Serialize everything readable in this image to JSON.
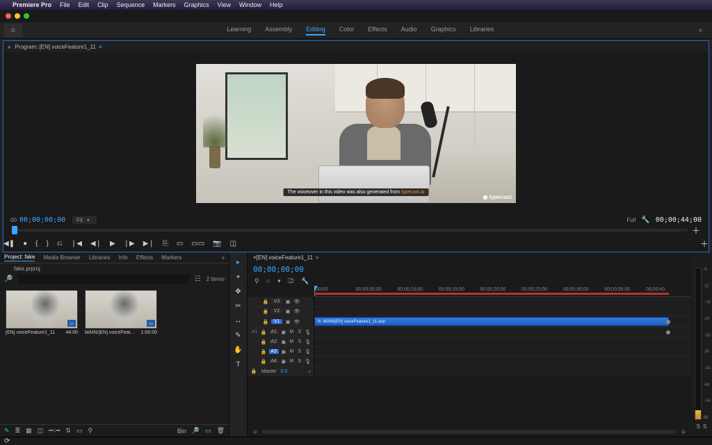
{
  "menubar": {
    "app": "Premiere Pro",
    "items": [
      "File",
      "Edit",
      "Clip",
      "Sequence",
      "Markers",
      "Graphics",
      "View",
      "Window",
      "Help"
    ]
  },
  "workspaces": {
    "items": [
      "Learning",
      "Assembly",
      "Editing",
      "Color",
      "Effects",
      "Audio",
      "Graphics",
      "Libraries"
    ],
    "active": "Editing"
  },
  "program": {
    "tab_label": "Program: [EN] voiceFeature1_11",
    "subtitle_pre": "The voiceover in this video was also generated from ",
    "subtitle_hl": "typecast.ai",
    "watermark": "typecast",
    "timecode": "00;00;00;00",
    "fit_label": "Fit",
    "full_label": "Full",
    "duration": "00;00;44;00",
    "left_label": "00"
  },
  "transport_icons": [
    "◀❚",
    "●",
    "{",
    "}",
    "⎌",
    "❘◀",
    "◀❘",
    "▶",
    "❘▶",
    "▶❘",
    "⎘",
    "▭",
    "▭▭",
    "📷",
    "◫"
  ],
  "project": {
    "tabs": [
      "Project: fake",
      "Media Browser",
      "Libraries",
      "Info",
      "Effects",
      "Markers"
    ],
    "file_label": "fake.prproj",
    "search_placeholder": "",
    "item_count": "2 Items",
    "bins": [
      {
        "name": "[EN] voiceFeature1_11",
        "dur": "44:00"
      },
      {
        "name": "MAIN/[EN] voiceFeature1...",
        "dur": "1:00:00"
      }
    ],
    "footer_label": "Bin"
  },
  "tools": [
    "▸",
    "⌖",
    "✥",
    "✂",
    "↔",
    "✎",
    "✋",
    "T"
  ],
  "timeline": {
    "tab_label": "[EN] voiceFeature1_11",
    "timecode": "00;00;00;00",
    "ruler": [
      ";00;00",
      "00;00;05;00",
      "00;00;10;00",
      "00;00;15;00",
      "00;00;20;00",
      "00;00;25;00",
      "00;00;30;00",
      "00;00;35;00",
      "00;00;40"
    ],
    "video_tracks": [
      {
        "label": "V3",
        "on": false
      },
      {
        "label": "V2",
        "on": false
      },
      {
        "label": "V1",
        "on": true
      }
    ],
    "audio_tracks": [
      {
        "src": "A1",
        "label": "A1",
        "on": false
      },
      {
        "label": "A2",
        "on": false
      },
      {
        "label": "A3",
        "on": true
      },
      {
        "label": "A4",
        "on": false
      }
    ],
    "clip_name": "MAIN/[EN] voiceFeature1_11.aep",
    "master_label": "Master",
    "master_value": "0.0"
  },
  "meters": {
    "scale": [
      "-6",
      "-12",
      "--18",
      "-24",
      "--30",
      "-36",
      "--42",
      "-48",
      "--54",
      "dB"
    ],
    "footer": [
      "S",
      "S"
    ]
  }
}
